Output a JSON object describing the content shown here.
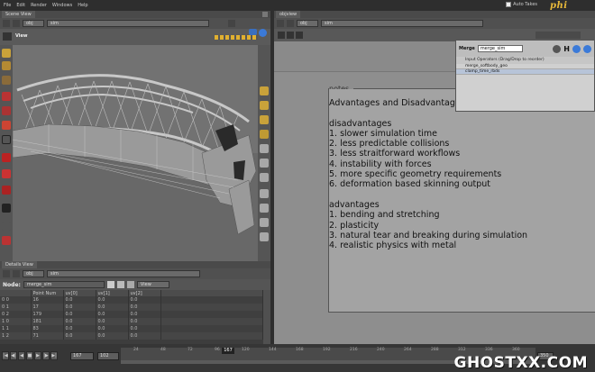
{
  "menubar": {
    "items": [
      "File",
      "Edit",
      "Render",
      "Windows",
      "Help"
    ],
    "auto_takes": "Auto Takes",
    "logo": "phi"
  },
  "scene_view": {
    "tab": "Scene View",
    "path": [
      "obj",
      "sim"
    ],
    "view_label": "View"
  },
  "details_view": {
    "tab": "Details View",
    "path": [
      "obj",
      "sim"
    ],
    "node_label": "Node:",
    "node_value": "merge_sim",
    "view_select": "View",
    "columns": [
      "",
      "Point Num",
      "uv[0]",
      "uv[1]",
      "uv[2]"
    ],
    "rows": [
      [
        "0 0",
        "16",
        "0.0",
        "0.0",
        "0.0"
      ],
      [
        "0 1",
        "17",
        "0.0",
        "0.0",
        "0.0"
      ],
      [
        "0 2",
        "179",
        "0.0",
        "0.0",
        "0.0"
      ],
      [
        "1 0",
        "181",
        "0.0",
        "0.0",
        "0.0"
      ],
      [
        "1 1",
        "83",
        "0.0",
        "0.0",
        "0.0"
      ],
      [
        "1 2",
        "71",
        "0.0",
        "0.0",
        "0.0"
      ]
    ]
  },
  "network": {
    "tab": "objview",
    "path": [
      "obj",
      "sim"
    ]
  },
  "notes": {
    "label": "notes",
    "text": "Advantages and Disadvantage\n\ndisadvantages\n1. slower simulation time\n2. less predictable collisions\n3. less straitforward workflows\n4. instability with forces\n5. more specific geometry requirements\n6. deformation based skinning output\n\nadvantages\n1. bending and stretching\n2. plasticity\n3. natural tear and breaking during simulation\n4. realistic physics with metal"
  },
  "merge_panel": {
    "type": "Merge",
    "name": "merge_sim",
    "subheader": "Input Operators (Drag/Drop to reorder)",
    "inputs": [
      "merge_softbody_geo",
      "clamp_time_rbds"
    ]
  },
  "timeline": {
    "start_frame": "167",
    "end_frame": "102",
    "current_frame": "167",
    "ticks": [
      "24",
      "48",
      "72",
      "96",
      "120",
      "144",
      "168",
      "192",
      "216",
      "240",
      "264",
      "288",
      "312",
      "336",
      "360"
    ],
    "end_field": "350"
  },
  "watermark": "GHOSTXX.COM"
}
